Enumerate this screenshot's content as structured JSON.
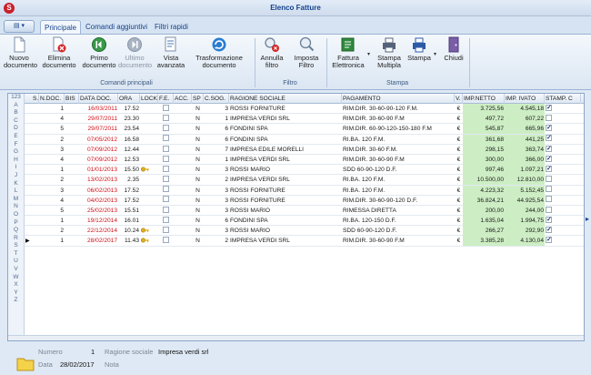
{
  "window": {
    "title": "Elenco Fatture"
  },
  "tabs": [
    {
      "label": "Principale",
      "active": true
    },
    {
      "label": "Comandi aggiuntivi",
      "active": false
    },
    {
      "label": "Filtri rapidi",
      "active": false
    }
  ],
  "ribbon": {
    "groups": {
      "main": "Comandi principali",
      "filter": "Filtro",
      "print": "Stampa"
    },
    "buttons": {
      "nuovo": "Nuovo documento",
      "elimina": "Elimina documento",
      "primo": "Primo documento",
      "ultimo": "Ultimo documento",
      "vista": "Vista avanzata",
      "trasformazione": "Trasformazione documento",
      "annulla": "Annulla filtro",
      "imposta": "Imposta Filtro",
      "fattura": "Fattura Elettronica",
      "stampa_multipla": "Stampa Multipla",
      "stampa": "Stampa",
      "chiudi": "Chiudi"
    }
  },
  "alpha_index": [
    "123",
    "A",
    "B",
    "C",
    "D",
    "E",
    "F",
    "G",
    "H",
    "I",
    "J",
    "K",
    "L",
    "M",
    "N",
    "O",
    "P",
    "Q",
    "R",
    "S",
    "T",
    "U",
    "V",
    "W",
    "X",
    "Y",
    "Z"
  ],
  "columns": {
    "s": "S.",
    "ndoc": "N.DOC.",
    "bis": "BIS",
    "data": "DATA DOC.",
    "ora": "ORA",
    "lock": "LOCK",
    "fe": "F.E.",
    "acc": "ACC.",
    "sp": "SP",
    "csog": "C.SOG.",
    "ragione": "RAGIONE SOCIALE",
    "pagamento": "PAGAMENTO",
    "v": "V.",
    "netto": "IMP.NETTO",
    "ivato": "IMP. IVATO",
    "stamp": "STAMP. C"
  },
  "rows": [
    {
      "ndoc": "1",
      "data": "16/03/2011",
      "ora": "17.52",
      "lock": false,
      "sp": "N",
      "csog": "3",
      "ragione": "ROSSI FORNITURE",
      "pagamento": "RIM.DIR. 30-60-90-120 F.M.",
      "v": "€",
      "netto": "3.725,56",
      "ivato": "4.545,18",
      "stamp": true
    },
    {
      "ndoc": "4",
      "data": "29/07/2011",
      "ora": "23.30",
      "lock": false,
      "sp": "N",
      "csog": "1",
      "ragione": "IMPRESA VERDI SRL",
      "pagamento": "RIM.DIR. 30-60-90 F.M",
      "v": "€",
      "netto": "497,72",
      "ivato": "607,22",
      "stamp": false
    },
    {
      "ndoc": "5",
      "data": "29/07/2011",
      "ora": "23.54",
      "lock": false,
      "sp": "N",
      "csog": "6",
      "ragione": "FONDINI SPA",
      "pagamento": "RIM.DIR. 60-90-120-150-180 F.M",
      "v": "€",
      "netto": "545,87",
      "ivato": "665,96",
      "stamp": true
    },
    {
      "ndoc": "2",
      "data": "07/05/2012",
      "ora": "16.58",
      "lock": false,
      "sp": "N",
      "csog": "6",
      "ragione": "FONDINI SPA",
      "pagamento": "RI.BA. 120 F.M.",
      "v": "€",
      "netto": "361,68",
      "ivato": "441,25",
      "stamp": true
    },
    {
      "ndoc": "3",
      "data": "07/09/2012",
      "ora": "12.44",
      "lock": false,
      "sp": "N",
      "csog": "7",
      "ragione": "IMPRESA EDILE MORELLI",
      "pagamento": "RIM.DIR. 30-60 F.M.",
      "v": "€",
      "netto": "298,15",
      "ivato": "363,74",
      "stamp": true
    },
    {
      "ndoc": "4",
      "data": "07/09/2012",
      "ora": "12.53",
      "lock": false,
      "sp": "N",
      "csog": "1",
      "ragione": "IMPRESA VERDI SRL",
      "pagamento": "RIM.DIR. 30-60-90 F.M",
      "v": "€",
      "netto": "300,00",
      "ivato": "366,00",
      "stamp": true
    },
    {
      "ndoc": "1",
      "data": "01/01/2013",
      "ora": "15.50",
      "lock": true,
      "sp": "N",
      "csog": "3",
      "ragione": "ROSSI MARIO",
      "pagamento": "SDD 60-90-120 D.F.",
      "v": "€",
      "netto": "997,46",
      "ivato": "1.097,21",
      "stamp": true
    },
    {
      "ndoc": "2",
      "data": "13/02/2013",
      "ora": "2.35",
      "lock": false,
      "sp": "N",
      "csog": "2",
      "ragione": "IMPRESA VERDI SRL",
      "pagamento": "RI.BA. 120 F.M.",
      "v": "€",
      "netto": "10.500,00",
      "ivato": "12.810,00",
      "stamp": false
    },
    {
      "ndoc": "3",
      "data": "06/02/2013",
      "ora": "17.52",
      "lock": false,
      "sp": "N",
      "csog": "3",
      "ragione": "ROSSI FORNITURE",
      "pagamento": "RI.BA. 120 F.M.",
      "v": "€",
      "netto": "4.223,32",
      "ivato": "5.152,45",
      "stamp": false
    },
    {
      "ndoc": "4",
      "data": "04/02/2013",
      "ora": "17.52",
      "lock": false,
      "sp": "N",
      "csog": "3",
      "ragione": "ROSSI FORNITURE",
      "pagamento": "RIM.DIR. 30-60-90-120 D.F.",
      "v": "€",
      "netto": "36.824,21",
      "ivato": "44.925,54",
      "stamp": false
    },
    {
      "ndoc": "5",
      "data": "25/02/2013",
      "ora": "15.51",
      "lock": false,
      "sp": "N",
      "csog": "3",
      "ragione": "ROSSI MARIO",
      "pagamento": "RIMESSA DIRETTA",
      "v": "€",
      "netto": "200,00",
      "ivato": "244,00",
      "stamp": false
    },
    {
      "ndoc": "1",
      "data": "19/12/2014",
      "ora": "16.01",
      "lock": false,
      "sp": "N",
      "csog": "6",
      "ragione": "FONDINI SPA",
      "pagamento": "RI.BA. 120-150 D.F.",
      "v": "€",
      "netto": "1.635,04",
      "ivato": "1.994,75",
      "stamp": true
    },
    {
      "ndoc": "2",
      "data": "22/12/2014",
      "ora": "10.24",
      "lock": true,
      "sp": "N",
      "csog": "3",
      "ragione": "ROSSI MARIO",
      "pagamento": "SDD 60-90-120 D.F.",
      "v": "€",
      "netto": "266,27",
      "ivato": "292,90",
      "stamp": true
    },
    {
      "ndoc": "1",
      "data": "28/02/2017",
      "ora": "11.43",
      "lock": true,
      "sp": "N",
      "csog": "2",
      "ragione": "IMPRESA VERDI SRL",
      "pagamento": "RIM.DIR. 30-60-90 F.M",
      "v": "€",
      "netto": "3.385,28",
      "ivato": "4.130,04",
      "stamp": true,
      "current": true
    }
  ],
  "footer": {
    "numero_label": "Numero",
    "numero_value": "1",
    "data_label": "Data",
    "data_value": "28/02/2017",
    "ragione_label": "Ragione sociale",
    "ragione_value": "Impresa verdi srl",
    "nota_label": "Nota"
  },
  "colors": {
    "accent": "#15428b",
    "red_date": "#d0101a",
    "green_cell": "#cdeec4"
  }
}
